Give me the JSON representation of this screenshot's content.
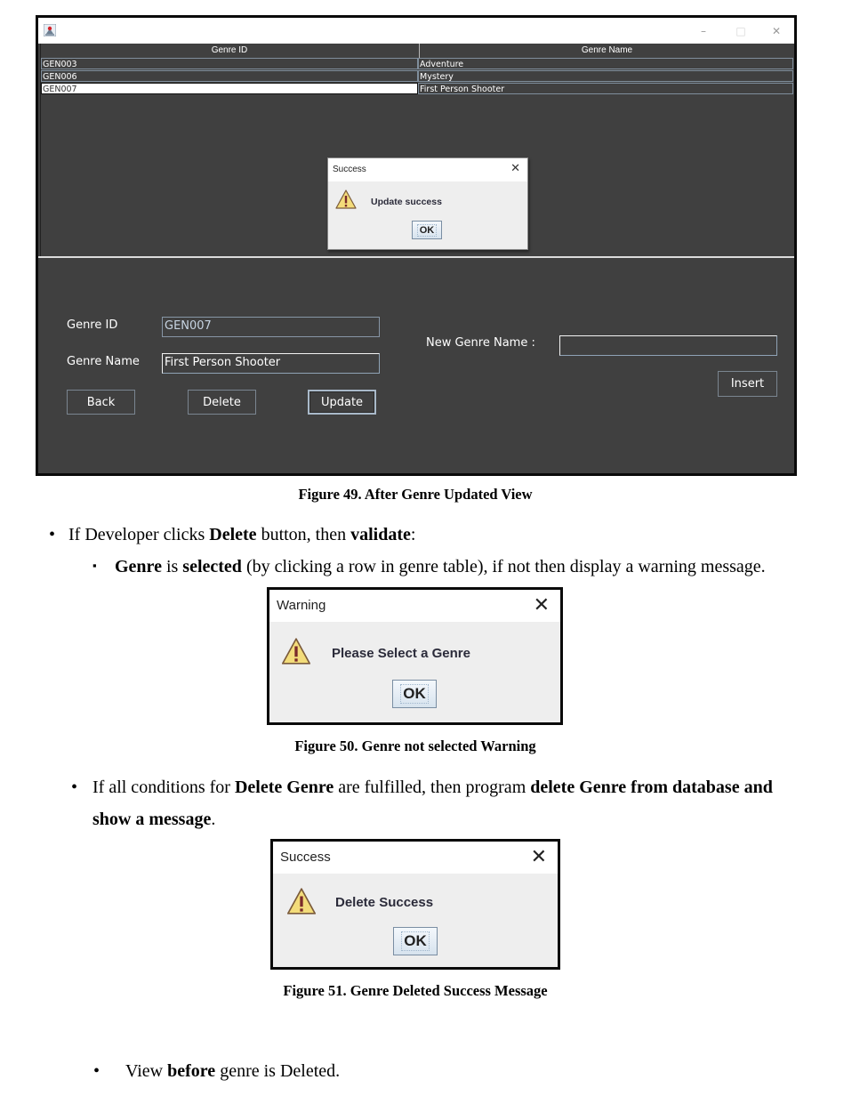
{
  "app_window": {
    "title": "",
    "icon": "java-app-icon",
    "controls": {
      "minimize": "–",
      "maximize": "□",
      "close": "✕"
    },
    "table": {
      "columns": [
        "Genre ID",
        "Genre Name"
      ],
      "rows": [
        {
          "id": "GEN003",
          "name": "Adventure",
          "selected": false
        },
        {
          "id": "GEN006",
          "name": "Mystery",
          "selected": false
        },
        {
          "id": "GEN007",
          "name": "First Person Shooter",
          "selected": true
        }
      ]
    },
    "dialog": {
      "title": "Success",
      "close": "✕",
      "message": "Update success",
      "icon": "warning-icon",
      "ok_label": "OK"
    },
    "form": {
      "genre_id_label": "Genre ID",
      "genre_id_value": "GEN007",
      "genre_name_label": "Genre Name",
      "genre_name_value": "First Person Shooter",
      "new_genre_name_label": "New Genre Name :",
      "new_genre_name_value": "",
      "back_label": "Back",
      "delete_label": "Delete",
      "update_label": "Update",
      "insert_label": "Insert"
    }
  },
  "document": {
    "figure49_caption": "Figure 49. After Genre Updated View",
    "para1": {
      "bullet": "•",
      "parts": [
        "If Developer clicks ",
        "Delete",
        " button, then ",
        "validate",
        ":"
      ]
    },
    "para2": {
      "bullet": "▪",
      "parts": [
        "Genre",
        " is ",
        "selected",
        " (by clicking a row in genre table), if not then display a warning message."
      ]
    },
    "warning_dialog": {
      "title": "Warning",
      "close": "✕",
      "message": "Please Select a Genre",
      "icon": "warning-icon",
      "ok_label": "OK"
    },
    "figure50_caption": "Figure 50. Genre not selected Warning",
    "para3": {
      "bullet": "•",
      "line1_parts": [
        "If all conditions for ",
        "Delete Genre",
        " are fulfilled, then program ",
        "delete Genre from database and"
      ],
      "line2_parts": [
        "show a message",
        "."
      ]
    },
    "delete_dialog": {
      "title": "Success",
      "close": "✕",
      "message": "Delete Success",
      "icon": "warning-icon",
      "ok_label": "OK"
    },
    "figure51_caption": "Figure 51. Genre Deleted Success Message",
    "para4": {
      "bullet": "•",
      "parts": [
        "View ",
        "before",
        " genre is Deleted."
      ]
    }
  }
}
